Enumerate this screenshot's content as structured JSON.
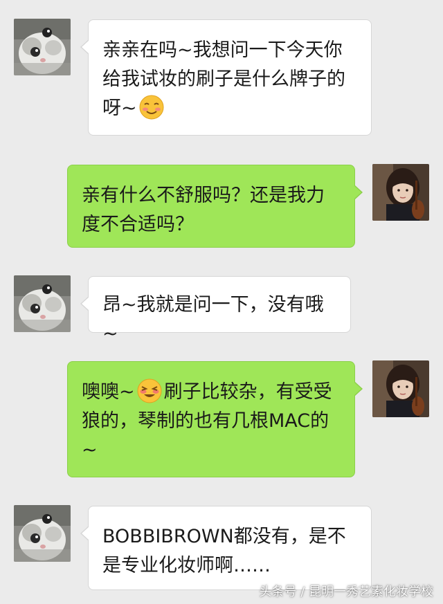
{
  "chat": {
    "messages": [
      {
        "sender": "customer",
        "direction": "incoming",
        "text_before": "亲亲在吗~我想问一下今天你给我试妆的刷子是什么牌子的呀~",
        "emoji": "smiling-blush-emoji",
        "text_after": ""
      },
      {
        "sender": "artist",
        "direction": "outgoing",
        "text_before": "亲有什么不舒服吗？还是我力度不合适吗？",
        "emoji": "",
        "text_after": ""
      },
      {
        "sender": "customer",
        "direction": "incoming",
        "text_before": "昂~我就是问一下，没有哦~",
        "emoji": "",
        "text_after": ""
      },
      {
        "sender": "artist",
        "direction": "outgoing",
        "text_before": "噢噢~",
        "emoji": "shy-grin-emoji",
        "text_after": "刷子比较杂，有受受狼的，琴制的也有几根MAC的~"
      },
      {
        "sender": "customer",
        "direction": "incoming",
        "text_before": "BOBBIBROWN都没有，是不是专业化妆师啊……",
        "emoji": "",
        "text_after": ""
      }
    ]
  },
  "avatars": {
    "customer": "cat-avatar",
    "artist": "girl-avatar"
  },
  "watermark": {
    "text": "头条号 / 昆明一秀艺素化妆学校"
  },
  "colors": {
    "background": "#ebebeb",
    "incoming_bubble": "#ffffff",
    "outgoing_bubble": "#9fe658",
    "text": "#1a1a1a"
  }
}
